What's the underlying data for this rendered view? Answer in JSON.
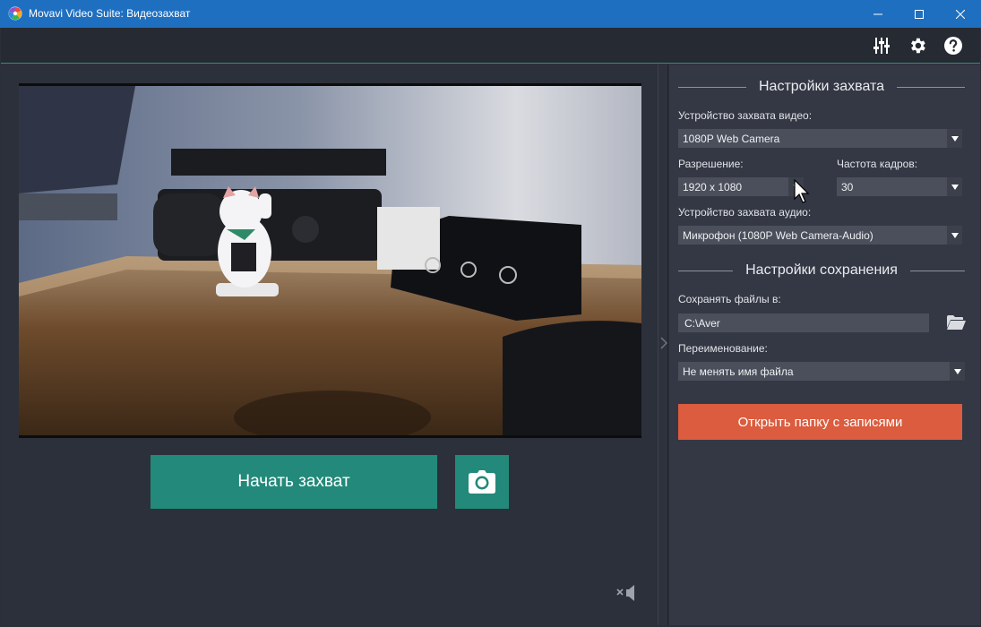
{
  "window": {
    "title": "Movavi Video Suite: Видеозахват"
  },
  "toolbar": {
    "icons": [
      "equalizer-icon",
      "gear-icon",
      "help-icon"
    ]
  },
  "preview": {
    "description_icon": "camera-preview"
  },
  "actions": {
    "start_label": "Начать захват",
    "snapshot_icon": "camera-icon"
  },
  "capture_settings": {
    "heading": "Настройки захвата",
    "video_device_label": "Устройство захвата видео:",
    "video_device_value": "1080P Web Camera",
    "resolution_label": "Разрешение:",
    "resolution_value": "1920 x 1080",
    "framerate_label": "Частота кадров:",
    "framerate_value": "30",
    "audio_device_label": "Устройство захвата аудио:",
    "audio_device_value": "Микрофон (1080P Web Camera-Audio)"
  },
  "save_settings": {
    "heading": "Настройки сохранения",
    "save_to_label": "Сохранять файлы в:",
    "save_to_value": "C:\\Aver",
    "rename_label": "Переименование:",
    "rename_value": "Не менять имя файла",
    "open_folder_label": "Открыть папку с записями"
  },
  "colors": {
    "titlebar": "#1f6fc0",
    "accent_green": "#23897a",
    "accent_orange": "#db5c3e",
    "panel_dark": "#2c303b",
    "panel_right": "#343844"
  }
}
